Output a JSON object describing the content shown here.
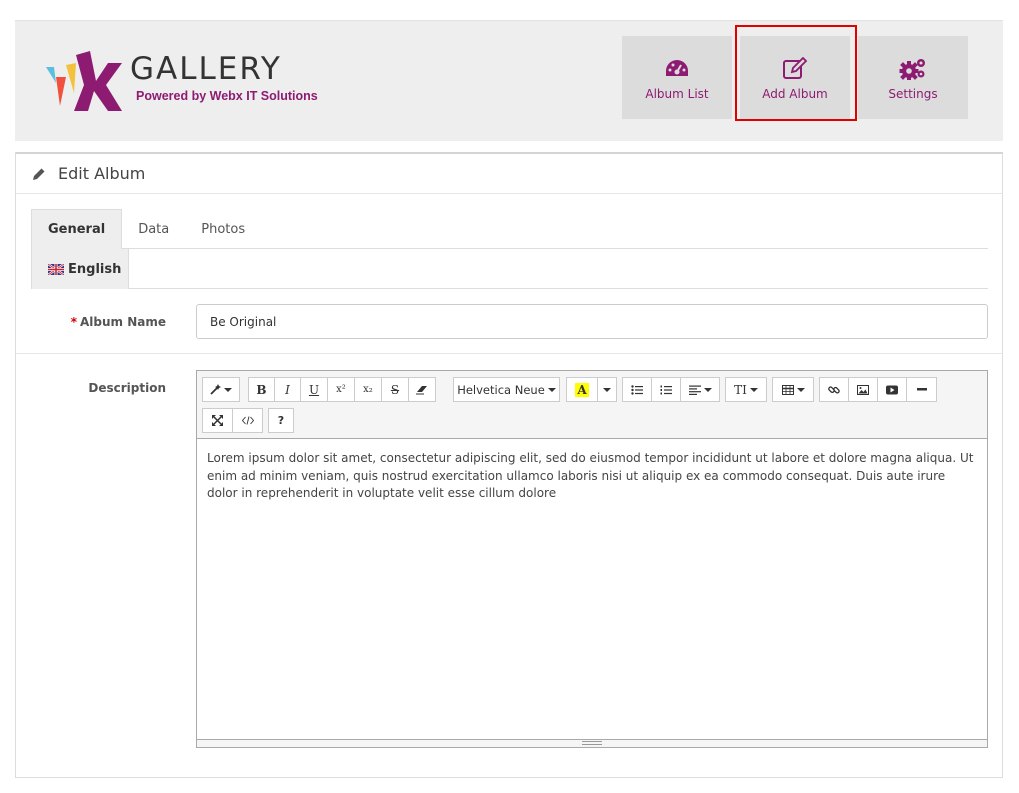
{
  "header": {
    "logo_text": "GALLERY",
    "logo_subtitle": "Powered by Webx IT Solutions",
    "nav": [
      {
        "label": "Album List",
        "icon": "dashboard-icon"
      },
      {
        "label": "Add Album",
        "icon": "edit-icon"
      },
      {
        "label": "Settings",
        "icon": "gears-icon"
      }
    ]
  },
  "panel": {
    "title": "Edit Album",
    "tabs": [
      "General",
      "Data",
      "Photos"
    ],
    "active_tab": "General",
    "language_tab": "English"
  },
  "form": {
    "album_name_label": "Album Name",
    "required_mark": "*",
    "album_name_value": "Be Original",
    "description_label": "Description"
  },
  "editor": {
    "font_name": "Helvetica Neue",
    "buttons": {
      "bold": "B",
      "italic": "I",
      "underline": "U",
      "superscript": "x²",
      "subscript": "x₂",
      "strikethrough": "S",
      "color": "A",
      "font_size": "TI",
      "help": "?"
    },
    "content": "Lorem ipsum dolor sit amet, consectetur adipiscing elit, sed do eiusmod tempor incididunt ut labore et dolore magna aliqua. Ut enim ad minim veniam, quis nostrud exercitation ullamco laboris nisi ut aliquip ex ea commodo consequat. Duis aute irure dolor in reprehenderit in voluptate velit esse cillum dolore"
  },
  "colors": {
    "brand": "#8e1b72",
    "highlight_border": "#e00000",
    "header_bg": "#eeeeee"
  }
}
